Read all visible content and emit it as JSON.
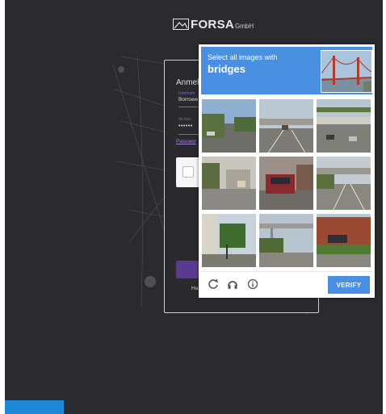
{
  "app": {
    "logo_text": "FORSA",
    "logo_suffix": "GmbH"
  },
  "login": {
    "title": "Anmelc",
    "username_label": "Usernam",
    "username_value": "Borrowe",
    "password_label": "de leer",
    "password_value": "••••••",
    "forgot_link": "Passwor",
    "help_text": "Ha"
  },
  "captcha": {
    "prompt": "Select all images with",
    "keyword": "bridges",
    "verify_label": "VERIFY",
    "footer_icons": [
      "reload-icon",
      "headphones-icon",
      "info-icon"
    ],
    "tiles": [
      {
        "id": 1,
        "scene": "street"
      },
      {
        "id": 2,
        "scene": "highway-overpass"
      },
      {
        "id": 3,
        "scene": "highway-bridge"
      },
      {
        "id": 4,
        "scene": "parking-lot"
      },
      {
        "id": 5,
        "scene": "cars-street"
      },
      {
        "id": 6,
        "scene": "highway-overpass"
      },
      {
        "id": 7,
        "scene": "street-trees"
      },
      {
        "id": 8,
        "scene": "pedestrian-bridge"
      },
      {
        "id": 9,
        "scene": "brick-building"
      }
    ],
    "colors": {
      "header": "#4a90e2",
      "verify": "#4a90e2"
    }
  }
}
